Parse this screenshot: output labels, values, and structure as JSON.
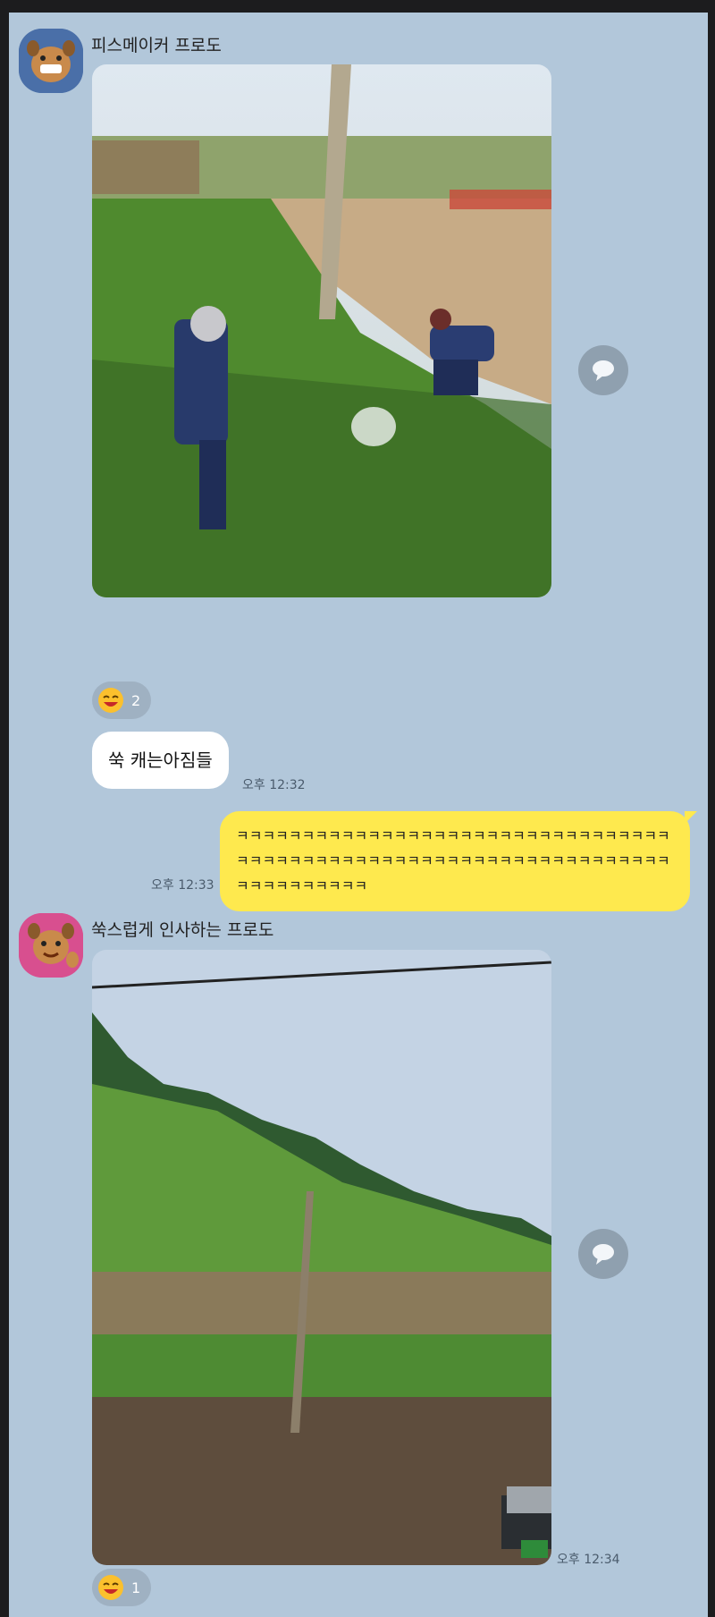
{
  "messages": [
    {
      "sender": "피스메이커 프로도",
      "reaction_count": "2"
    },
    {
      "text": "쑥 캐는아짐들",
      "time": "오후 12:32"
    },
    {
      "text": "ㅋㅋㅋㅋㅋㅋㅋㅋㅋㅋㅋㅋㅋㅋㅋㅋㅋㅋㅋㅋㅋㅋㅋㅋㅋㅋㅋㅋㅋㅋㅋㅋㅋㅋㅋㅋㅋㅋㅋㅋㅋㅋㅋㅋㅋㅋㅋㅋㅋㅋㅋㅋㅋㅋㅋㅋㅋㅋㅋㅋㅋㅋㅋㅋㅋㅋㅋㅋㅋㅋㅋㅋㅋㅋㅋㅋ",
      "time": "오후 12:33"
    },
    {
      "sender": "쑥스럽게 인사하는 프로도",
      "time": "오후 12:34",
      "reaction_count": "1"
    }
  ],
  "icons": {
    "share": "share-bubble-icon",
    "reaction": "laughing-emoji-icon"
  },
  "colors": {
    "background": "#b2c7da",
    "my_bubble": "#fee94e",
    "other_bubble": "#ffffff"
  }
}
